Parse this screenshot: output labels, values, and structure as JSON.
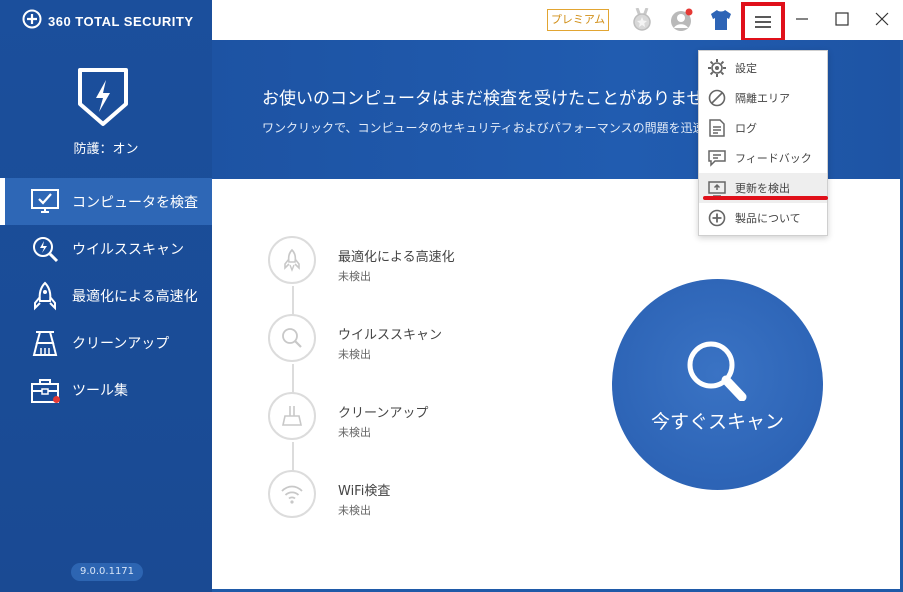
{
  "app": {
    "brand": "360 TOTAL SECURITY",
    "protection_status": "防護：オン",
    "version": "9.0.0.1171"
  },
  "sidebar": {
    "items": [
      {
        "label": "コンピュータを検査",
        "icon": "monitor-check-icon",
        "active": true
      },
      {
        "label": "ウイルススキャン",
        "icon": "virus-scan-icon",
        "active": false
      },
      {
        "label": "最適化による高速化",
        "icon": "rocket-icon",
        "active": false
      },
      {
        "label": "クリーンアップ",
        "icon": "broom-icon",
        "active": false
      },
      {
        "label": "ツール集",
        "icon": "toolbox-icon",
        "active": false
      }
    ]
  },
  "titlebar": {
    "premium_label": "プレミアム"
  },
  "banner": {
    "title": "お使いのコンピュータはまだ検査を受けたことがありません",
    "subtitle": "ワンクリックで、コンピュータのセキュリティおよびパフォーマンスの問題を迅速かつ完全に解"
  },
  "steps": [
    {
      "title": "最適化による高速化",
      "status": "未検出",
      "icon": "rocket-icon"
    },
    {
      "title": "ウイルススキャン",
      "status": "未検出",
      "icon": "search-icon"
    },
    {
      "title": "クリーンアップ",
      "status": "未検出",
      "icon": "broom-icon"
    },
    {
      "title": "WiFi検査",
      "status": "未検出",
      "icon": "wifi-icon"
    }
  ],
  "scan": {
    "label": "今すぐスキャン"
  },
  "menu": {
    "items": [
      {
        "label": "設定",
        "icon": "gear-icon"
      },
      {
        "label": "隔離エリア",
        "icon": "ban-icon"
      },
      {
        "label": "ログ",
        "icon": "document-icon"
      },
      {
        "label": "フィードバック",
        "icon": "feedback-icon"
      },
      {
        "label": "更新を検出",
        "icon": "update-icon"
      },
      {
        "label": "製品について",
        "icon": "plus-circle-icon"
      }
    ]
  },
  "colors": {
    "sidebar_bg": "#1b4f9c",
    "accent_red": "#e0101a",
    "scan_blue": "#2d64b6",
    "premium_gold": "#d18f18"
  }
}
